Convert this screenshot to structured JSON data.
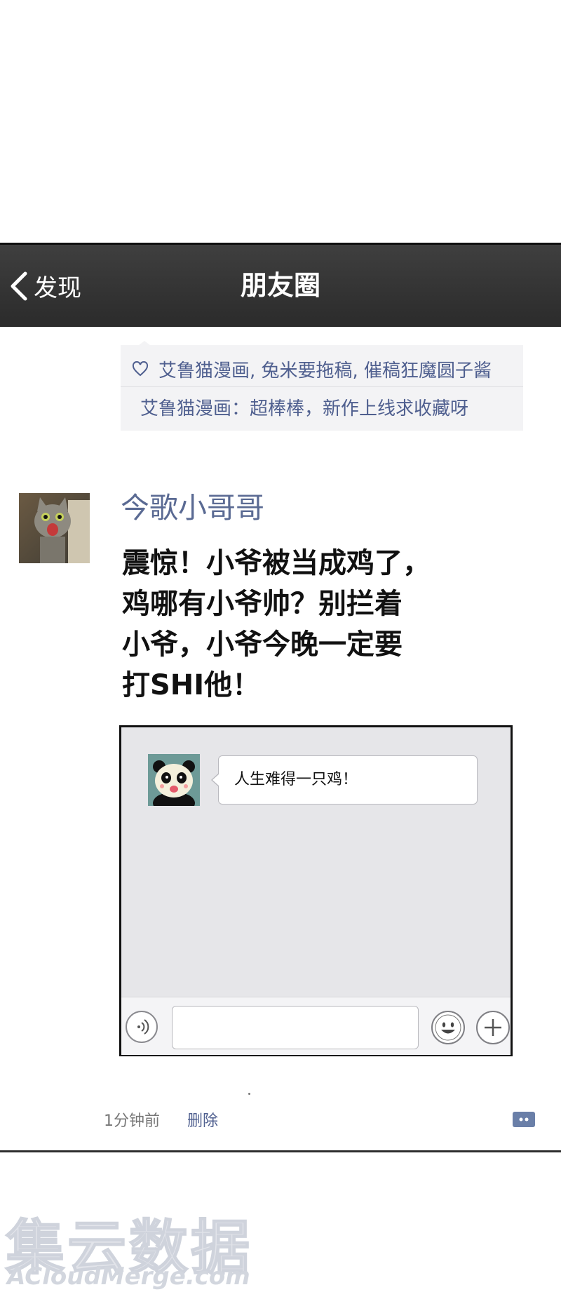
{
  "navbar": {
    "back_label": "发现",
    "title": "朋友圈"
  },
  "likes": {
    "names": "艾鲁猫漫画, 兔米要拖稿, 催稿狂魔圆子酱",
    "comment": "艾鲁猫漫画：超棒棒，新作上线求收藏呀"
  },
  "post": {
    "author": "今歌小哥哥",
    "lines": [
      "震惊！小爷被当成鸡了，",
      "鸡哪有小爷帅？别拦着",
      "小爷，小爷今晚一定要",
      "打SHI他！"
    ]
  },
  "chat_card": {
    "message": "人生难得一只鸡！"
  },
  "meta": {
    "time": "1分钟前",
    "delete": "删除"
  },
  "watermark": {
    "line1": "集云数据",
    "line2": "ACloudMerge.com"
  }
}
